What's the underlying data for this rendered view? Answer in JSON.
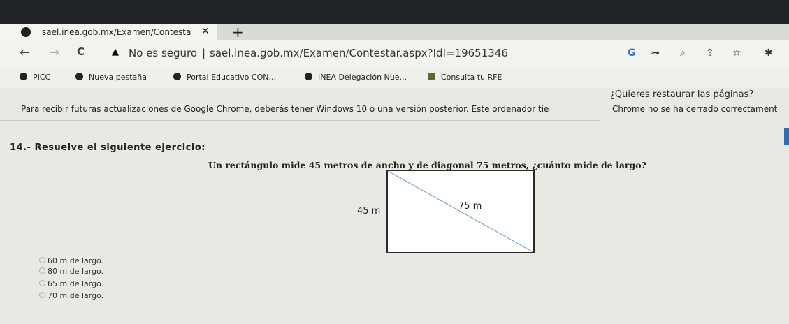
{
  "tab": {
    "title": "sael.inea.gob.mx/Examen/Contesta",
    "close": "✕"
  },
  "new_tab": "+",
  "tab_menu": "⌄",
  "nav": {
    "back": "←",
    "forward": "→",
    "reload": "C"
  },
  "omnibox": {
    "warning_icon": "▲",
    "security_text": "No es seguro",
    "separator": "|",
    "url": "sael.inea.gob.mx/Examen/Contestar.aspx?IdI=19651346"
  },
  "toolbar_icons": {
    "google": "G",
    "key": "⊶",
    "zoom": "⌕",
    "share": "⇪",
    "star": "☆",
    "extension": "✱"
  },
  "bookmarks": [
    {
      "label": "PICC",
      "icon": "globe-icon"
    },
    {
      "label": "Nueva pestaña",
      "icon": "globe-icon"
    },
    {
      "label": "Portal Educativo CON...",
      "icon": "globe-icon"
    },
    {
      "label": "INEA Delegación Nue...",
      "icon": "person-icon"
    },
    {
      "label": "Consulta tu RFE",
      "icon": "image-icon"
    }
  ],
  "infobar": {
    "restore_question": "¿Quieres restaurar las páginas?",
    "windows_notice": "Para recibir futuras actualizaciones de Google Chrome, deberás tener Windows 10 o una versión posterior. Este ordenador tie",
    "crashed_notice": "Chrome no se ha cerrado correctament"
  },
  "question": {
    "title": "14.- Resuelve el siguiente ejercicio:",
    "text": "Un rectángulo mide 45 metros de ancho y de diagonal 75 metros, ¿cuánto mide de largo?",
    "figure": {
      "width_label": "45 m",
      "diagonal_label": "75 m"
    },
    "options": [
      "60 m de largo.",
      "80 m de largo.",
      "65 m de largo.",
      "70 m de largo."
    ]
  },
  "colors": {
    "page_bg": "#e9e9e4",
    "frame": "#1f2326",
    "accent": "#2d6db5"
  }
}
